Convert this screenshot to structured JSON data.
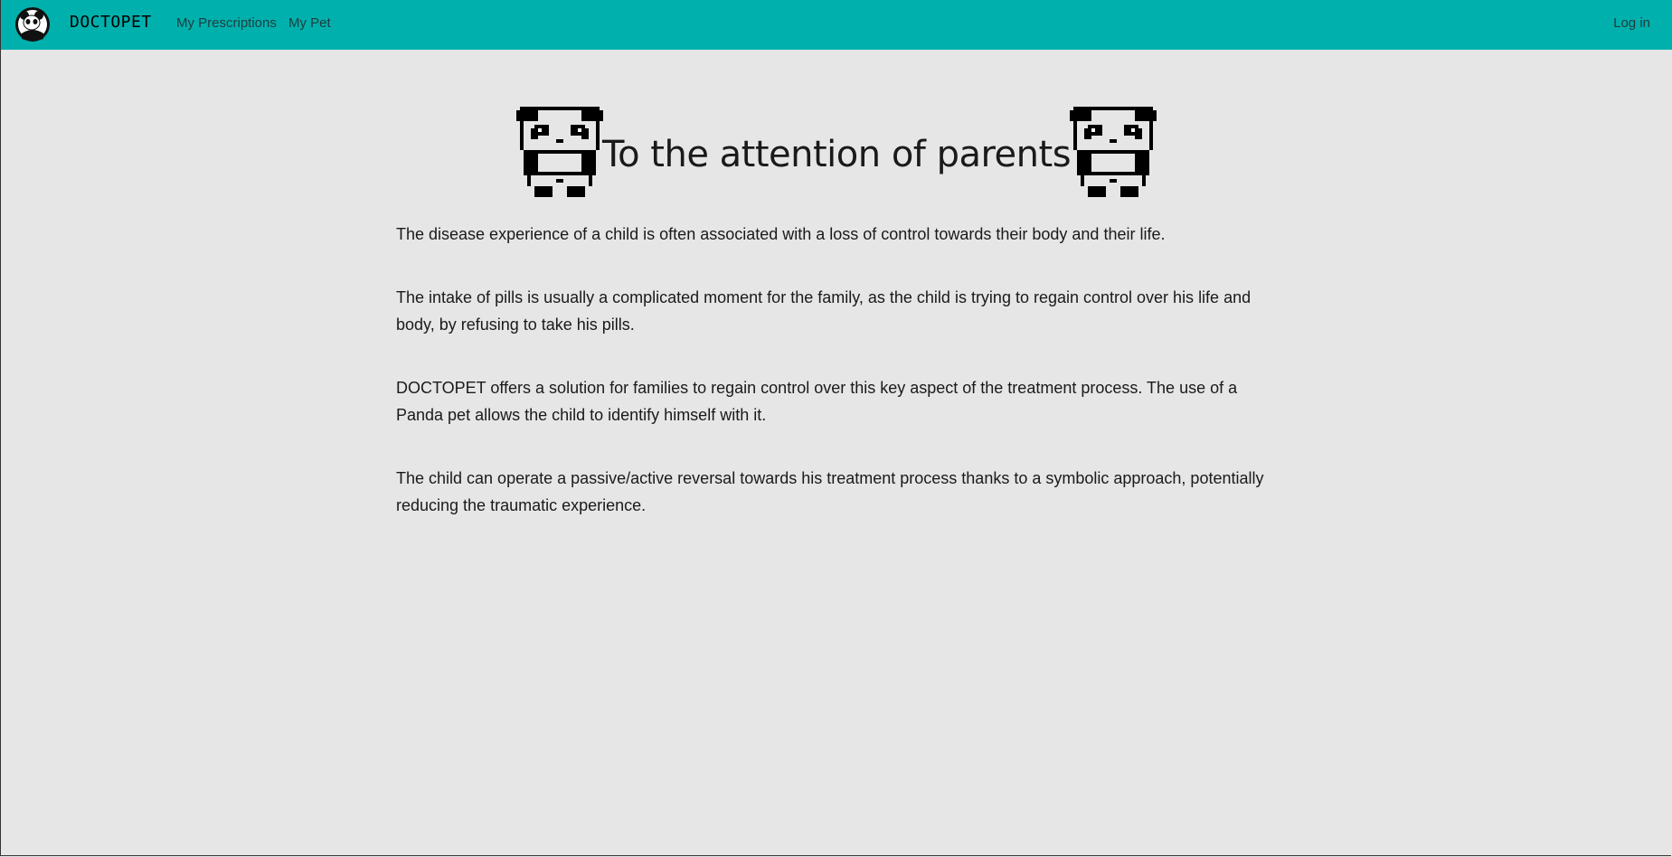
{
  "nav": {
    "logo_icon": "panda-logo-icon",
    "brand": "DOCTOPET",
    "links": [
      "My Prescriptions",
      "My Pet"
    ],
    "login": "Log in",
    "color": "#00b0ad"
  },
  "hero": {
    "title": "To the attention of parents",
    "icon": "pixel-panda-icon"
  },
  "paragraphs": [
    "The disease experience of a child is often associated with a loss of control towards their body and their life.",
    "The intake of pills is usually a complicated moment for the family, as the child is trying to regain control over his life and body, by refusing to take his pills.",
    "DOCTOPET offers a solution for families to regain control over this key aspect of the treatment process. The use of a Panda pet allows the child to identify himself with it.",
    "The child can operate a passive/active reversal towards his treatment process thanks to a symbolic approach, potentially reducing the traumatic experience."
  ]
}
